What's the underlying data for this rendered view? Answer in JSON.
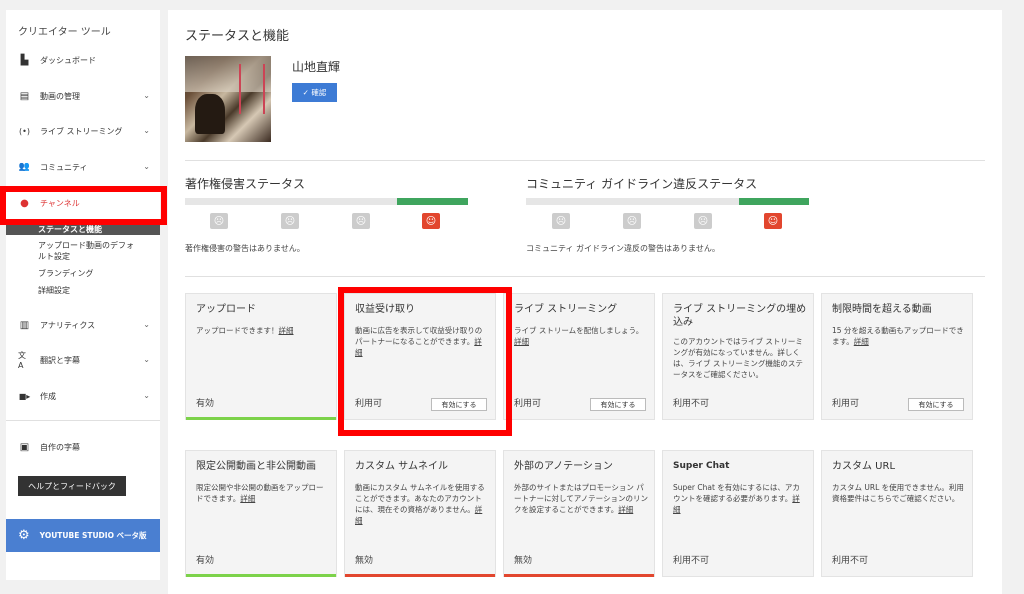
{
  "sidebar": {
    "title": "クリエイター ツール",
    "items": [
      {
        "label": "ダッシュボード",
        "icon": "dashboard-icon",
        "glyph": "▙"
      },
      {
        "label": "動画の管理",
        "icon": "video-manager-icon",
        "glyph": "▤"
      },
      {
        "label": "ライブ ストリーミング",
        "icon": "live-icon",
        "glyph": "(•)"
      },
      {
        "label": "コミュニティ",
        "icon": "community-icon",
        "glyph": "👥"
      },
      {
        "label": "チャンネル",
        "icon": "channel-icon",
        "glyph": "●"
      },
      {
        "label": "アナリティクス",
        "icon": "analytics-icon",
        "glyph": "▥"
      },
      {
        "label": "翻訳と字幕",
        "icon": "translate-icon",
        "glyph": "文A"
      },
      {
        "label": "作成",
        "icon": "create-icon",
        "glyph": "■▸"
      },
      {
        "label": "自作の字幕",
        "icon": "subtitle-icon",
        "glyph": "▣"
      }
    ],
    "channel_sub": [
      "ステータスと機能",
      "アップロード動画のデフォ",
      "ルト設定",
      "ブランディング",
      "詳細設定"
    ],
    "help_label": "ヘルプとフィードバック",
    "studio_label": "YOUTUBE STUDIO ベータ版"
  },
  "main": {
    "title": "ステータスと機能",
    "channel_name": "山地直輝",
    "verify_label": "✓ 確認",
    "copyright": {
      "title": "著作権侵害ステータス",
      "note": "著作権侵害の警告はありません。"
    },
    "community": {
      "title": "コミュニティ ガイドライン違反ステータス",
      "note": "コミュニティ ガイドライン違反の警告はありません。"
    },
    "cards_row1": [
      {
        "title": "アップロード",
        "desc": "アップロードできます！",
        "link": "詳細",
        "status": "有効",
        "button": "",
        "line": "green"
      },
      {
        "title": "収益受け取り",
        "desc": "動画に広告を表示して収益受け取りのパートナーになることができます。",
        "link": "詳細",
        "status": "利用可",
        "button": "有効にする",
        "line": ""
      },
      {
        "title": "ライブ ストリーミング",
        "desc": "ライブ ストリームを配信しましょう。",
        "link": "詳細",
        "status": "利用可",
        "button": "有効にする",
        "line": ""
      },
      {
        "title": "ライブ ストリーミングの埋め込み",
        "desc": "このアカウントではライブ ストリーミングが有効になっていません。詳しくは、ライブ ストリーミング機能のステータスをご確認ください。",
        "link": "",
        "status": "利用不可",
        "button": "",
        "line": ""
      },
      {
        "title": "制限時間を超える動画",
        "desc": "15 分を超える動画もアップロードできます。",
        "link": "詳細",
        "status": "利用可",
        "button": "有効にする",
        "line": ""
      }
    ],
    "cards_row2": [
      {
        "title": "限定公開動画と非公開動画",
        "desc": "限定公開や非公開の動画をアップロードできます。",
        "link": "詳細",
        "status": "有効",
        "line": "green"
      },
      {
        "title": "カスタム サムネイル",
        "desc": "動画にカスタム サムネイルを使用することができます。あなたのアカウントには、現在その資格がありません。",
        "link": "詳細",
        "status": "無効",
        "line": "red"
      },
      {
        "title": "外部のアノテーション",
        "desc": "外部のサイトまたはプロモーション パートナーに対してアノテーションのリンクを設定することができます。",
        "link": "詳細",
        "status": "無効",
        "line": "red"
      },
      {
        "title": "Super Chat",
        "desc": "Super Chat を有効にするには、アカウントを確認する必要があります。",
        "link": "詳細",
        "status": "利用不可",
        "line": ""
      },
      {
        "title": "カスタム URL",
        "desc": "カスタム URL を使用できません。利用資格要件はこちらでご確認ください。",
        "link": "",
        "status": "利用不可",
        "line": ""
      }
    ]
  }
}
